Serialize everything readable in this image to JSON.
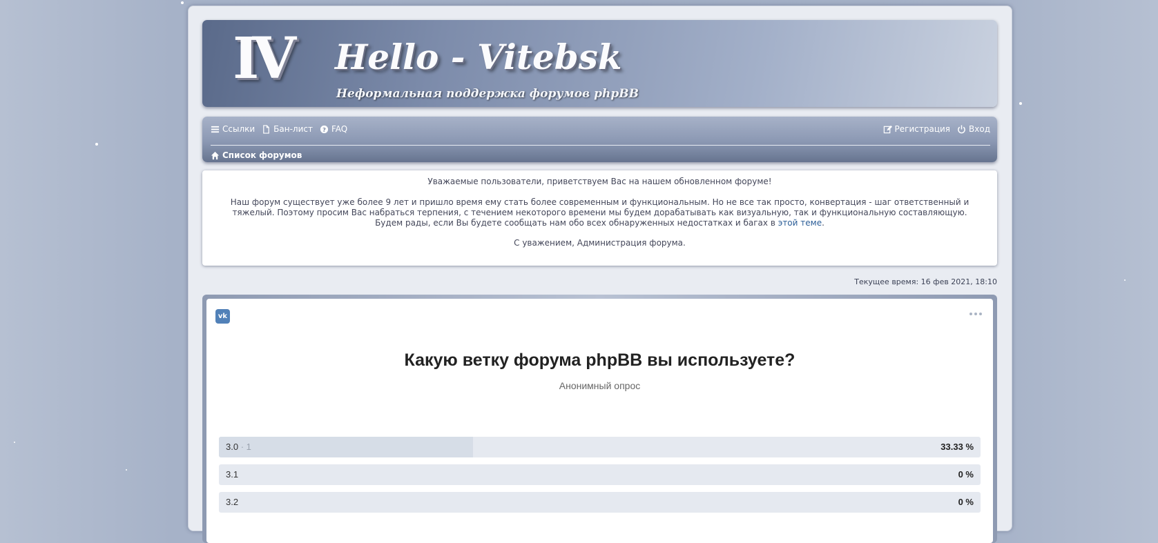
{
  "header": {
    "logo_text": "IV",
    "title": "Hello - Vitebsk",
    "description": "Неформальная поддержка форумов phpBB"
  },
  "nav": {
    "links_label": "Ссылки",
    "banlist_label": "Бан-лист",
    "faq_label": "FAQ",
    "register_label": "Регистрация",
    "login_label": "Вход",
    "breadcrumb_label": "Список форумов"
  },
  "notice": {
    "line1": "Уважаемые пользователи, приветствуем Вас на нашем обновленном форуме!",
    "body": "Наш форум существует уже более 9 лет и пришло время ему стать более современным и функциональным. Но не все так просто, конвертация - шаг ответственный и тяжелый. Поэтому просим Вас набраться терпения, с течением некоторого времени мы будем дорабатывать как визуальную, так и функциональную составляющую. Будем рады, если Вы будете сообщать нам обо всех обнаруженных недостатках и багах в",
    "link_text": "этой теме",
    "signature": "С уважением, Администрация форума."
  },
  "current_time": "Текущее время: 16 фев 2021, 18:10",
  "poll": {
    "vk_label": "vk",
    "question": "Какую ветку форума phpBB вы используете?",
    "subtitle": "Анонимный опрос",
    "options": [
      {
        "label": "3.0",
        "count": "· 1",
        "percent": "33.33 %",
        "fraction": 0.3333
      },
      {
        "label": "3.1",
        "count": "",
        "percent": "0 %",
        "fraction": 0
      },
      {
        "label": "3.2",
        "count": "",
        "percent": "0 %",
        "fraction": 0
      }
    ]
  },
  "colors": {
    "accent": "#5181b8",
    "nav": "#8b98b3",
    "link": "#2b5d97"
  }
}
